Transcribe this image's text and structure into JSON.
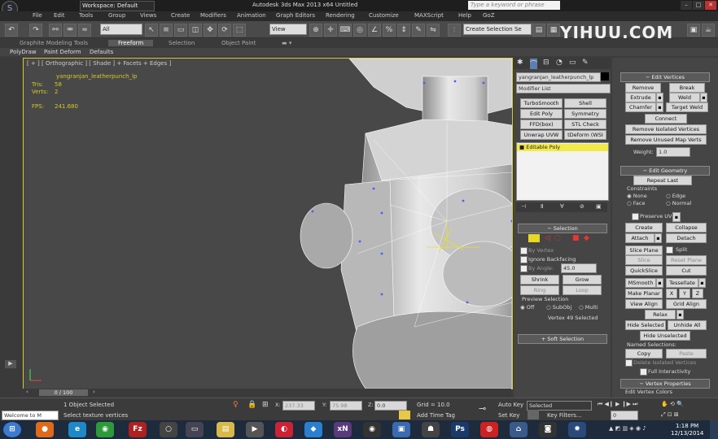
{
  "titlebar": {
    "workspace": "Workspace: Default",
    "title": "Autodesk 3ds Max  2013 x64      Untitled",
    "search_placeholder": "Type a keyword or phrase"
  },
  "menu": [
    "File",
    "Edit",
    "Tools",
    "Group",
    "Views",
    "Create",
    "Modifiers",
    "Animation",
    "Graph Editors",
    "Rendering",
    "Customize",
    "MAXScript",
    "Help",
    "GoZ"
  ],
  "toolbar": {
    "filter": "All",
    "view": "View",
    "selection_set": "Create Selection Se",
    "brand": "YIHUU.COM"
  },
  "ribbon": {
    "tabs": [
      "Graphite Modeling Tools",
      "Freeform",
      "Selection",
      "Object Paint"
    ],
    "subtabs": [
      "PolyDraw",
      "Paint Deform",
      "Defaults"
    ]
  },
  "viewport": {
    "label": "[ + ] [ Orthographic ] [ Shade ] + Facets + Edges ]",
    "object": "yangranjan_leatherpunch_lp",
    "tris_label": "Tris:",
    "tris_value": "58",
    "verts_label": "Verts:",
    "verts_value": "2",
    "fps_label": "FPS:",
    "fps_value": "241.680"
  },
  "modifier_panel": {
    "object_name": "yangranjan_leatherpunch_lp",
    "modifier_list": "Modifier List",
    "buttons": [
      "TurboSmooth",
      "Shell",
      "Edit Poly",
      "Symmetry",
      "FFD(box)",
      "STL Check",
      "Unwrap UVW",
      "tDeform (WSI"
    ],
    "stack_item": "Editable Poly"
  },
  "selection": {
    "title": "Selection",
    "by_vertex": "By Vertex",
    "ignore_backfacing": "Ignore Backfacing",
    "by_angle": "By Angle:",
    "angle_value": "45.0",
    "shrink": "Shrink",
    "grow": "Grow",
    "ring": "Ring",
    "loop": "Loop",
    "preview_title": "Preview Selection",
    "off": "Off",
    "subobj": "SubObj",
    "multi": "Multi",
    "status": "Vertex 49 Selected",
    "soft_selection": "Soft Selection"
  },
  "edit_vertices": {
    "title": "Edit Vertices",
    "buttons": [
      "Remove",
      "Break",
      "Extrude",
      "Weld",
      "Chamfer",
      "Target Weld",
      "Connect",
      "Remove Isolated Vertices",
      "Remove Unused Map Verts"
    ],
    "weight_label": "Weight:",
    "weight_value": "1.0"
  },
  "edit_geometry": {
    "title": "Edit Geometry",
    "repeat_last": "Repeat Last",
    "constraints": "Constraints",
    "none": "None",
    "edge": "Edge",
    "face": "Face",
    "normal": "Normal",
    "preserve_uvs": "Preserve UVs",
    "buttons": [
      "Create",
      "Collapse",
      "Attach",
      "Detach",
      "Slice Plane",
      "Split",
      "Slice",
      "Reset Plane",
      "QuickSlice",
      "Cut",
      "MSmooth",
      "Tessellate",
      "Make Planar",
      "X",
      "Y",
      "Z",
      "View Align",
      "Grid Align",
      "Relax",
      "Hide Selected",
      "Unhide All",
      "Hide Unselected"
    ],
    "named_selections": "Named Selections:",
    "copy": "Copy",
    "paste": "Paste",
    "delete_isolated": "Delete Isolated Vertices",
    "full_interactivity": "Full Interactivity",
    "vertex_properties": "Vertex Properties",
    "edit_vertex_colors": "Edit Vertex Colors"
  },
  "bottom": {
    "time": "0 / 100",
    "status1": "1 Object Selected",
    "status2": "Select texture vertices",
    "x_label": "X:",
    "x_value": "237.33",
    "y_label": "Y:",
    "y_value": "75.98",
    "z_label": "Z:",
    "z_value": "0.0",
    "grid": "Grid = 10.0",
    "add_time_tag": "Add Time Tag",
    "auto_key": "Auto Key",
    "auto_key_value": "Selected",
    "set_key": "Set Key",
    "key_filters": "Key Filters...",
    "frame": "0",
    "welcome": "Welcome to M"
  },
  "taskbar": {
    "time": "1:18 PM",
    "date": "12/13/2014"
  }
}
